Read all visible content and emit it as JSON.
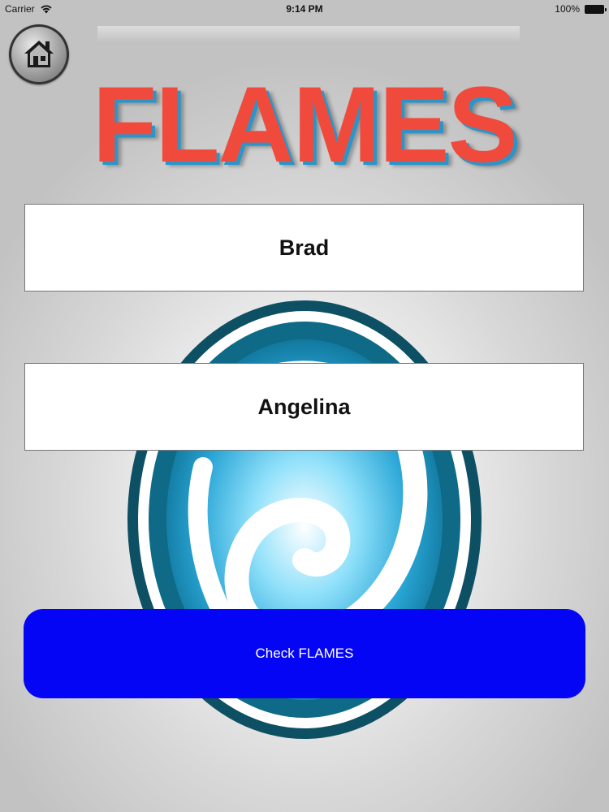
{
  "status_bar": {
    "carrier": "Carrier",
    "time": "9:14 PM",
    "battery": "100%"
  },
  "header": {
    "title": "FLAMES",
    "home_icon": "home-icon"
  },
  "form": {
    "first_name": "Brad",
    "second_name": "Angelina",
    "check_label": "Check FLAMES"
  },
  "colors": {
    "title_red": "#f04a3c",
    "title_shadow_blue": "#2c95c8",
    "button_blue": "#0505f5",
    "swirl_dark_teal": "#0d4f63",
    "swirl_light_blue": "#5fd0f5"
  }
}
